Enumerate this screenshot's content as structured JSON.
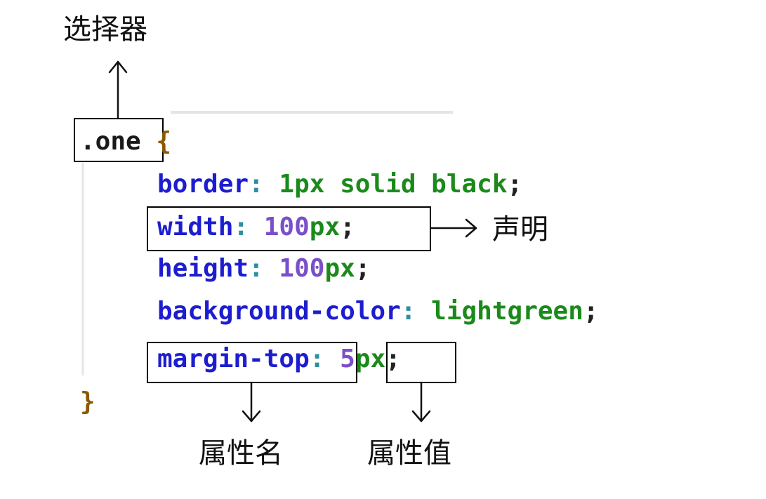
{
  "labels": {
    "selector": "选择器",
    "declaration": "声明",
    "property_name": "属性名",
    "property_value": "属性值"
  },
  "code": {
    "selector": ".one",
    "open_brace": "{",
    "close_brace": "}",
    "lines": [
      {
        "prop": "border",
        "colon": ":",
        "value": "1px solid black",
        "semi": ";"
      },
      {
        "prop": "width",
        "colon": ":",
        "number": "100",
        "unit": "px",
        "semi": ";"
      },
      {
        "prop": "height",
        "colon": ":",
        "number": "100",
        "unit": "px",
        "semi": ";"
      },
      {
        "prop": "background-color",
        "colon": ":",
        "value": "lightgreen",
        "semi": ";"
      },
      {
        "prop": "margin-top",
        "colon": ":",
        "number": "5",
        "unit": "px",
        "semi": ";"
      }
    ]
  },
  "colors": {
    "property": "#1d1dcf",
    "value": "#1b8a1b",
    "number": "#7a4fc8",
    "brace": "#8a5a00",
    "annotation": "#111111"
  }
}
